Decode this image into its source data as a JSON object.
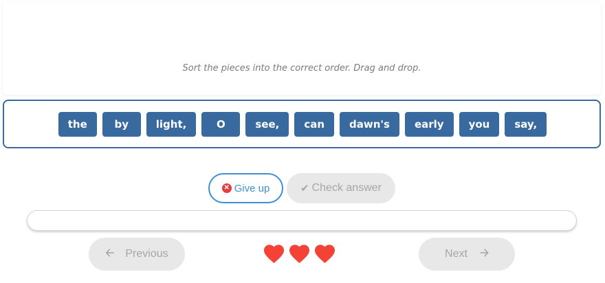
{
  "prompt": {
    "instruction": "Sort the pieces into the correct order. Drag and drop."
  },
  "pieces": [
    "the",
    "by",
    "light,",
    "O",
    "see,",
    "can",
    "dawn's",
    "early",
    "you",
    "say,"
  ],
  "actions": {
    "give_up_label": "Give up",
    "check_answer_label": "Check answer"
  },
  "progress": {
    "value": 0
  },
  "nav": {
    "previous_label": "Previous",
    "next_label": "Next"
  },
  "lives": {
    "count": 3,
    "color": "#f44336"
  },
  "colors": {
    "piece_bg": "#386a9f",
    "accent": "#3e8fd4",
    "disabled_bg": "#e8e8e8"
  }
}
